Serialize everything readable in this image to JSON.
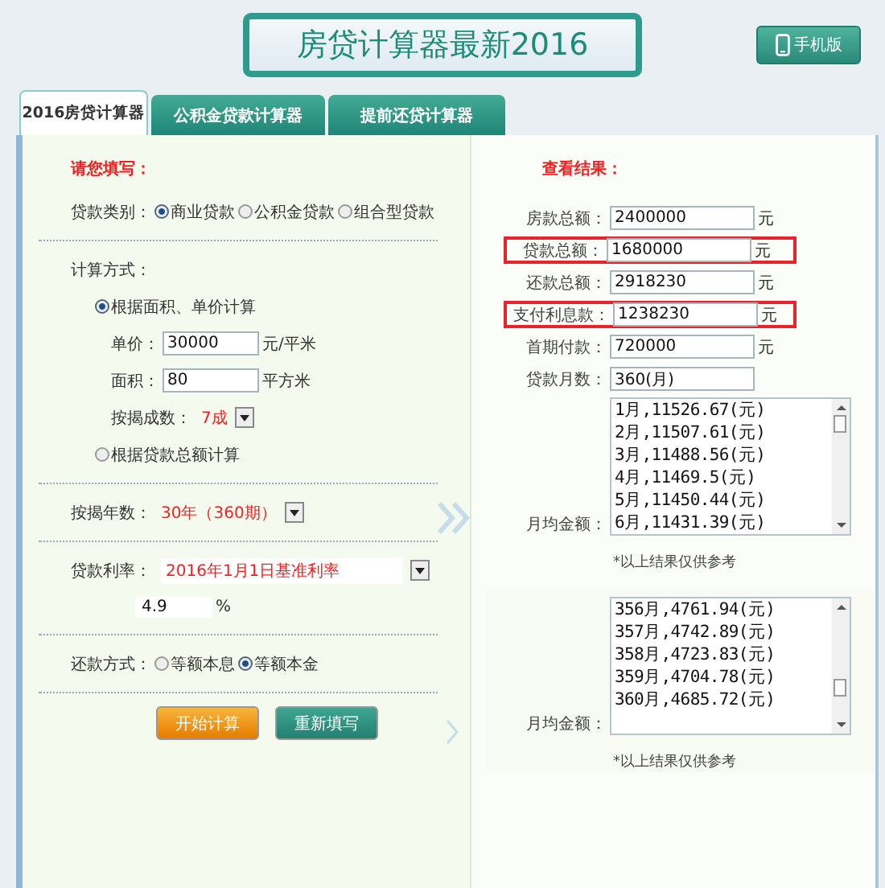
{
  "header": {
    "title": "房贷计算器最新2016",
    "mobile_button": "手机版"
  },
  "tabs": [
    {
      "label": "2016房贷计算器",
      "selected": true
    },
    {
      "label": "公积金贷款计算器",
      "selected": false
    },
    {
      "label": "提前还贷计算器",
      "selected": false
    }
  ],
  "form": {
    "heading": "请您填写：",
    "loan_type": {
      "label": "贷款类别：",
      "options": [
        {
          "label": "商业贷款",
          "selected": true
        },
        {
          "label": "公积金贷款",
          "selected": false
        },
        {
          "label": "组合型贷款",
          "selected": false
        }
      ]
    },
    "calc_label": "计算方式：",
    "calc_options": [
      {
        "label": "根据面积、单价计算",
        "selected": true,
        "fields": [
          {
            "label": "单价：",
            "value": "30000",
            "unit": "元/平米"
          },
          {
            "label": "面积：",
            "value": "80",
            "unit": "平方米"
          }
        ],
        "ratio": {
          "label": "按揭成数：",
          "value": "7成"
        }
      },
      {
        "label": "根据贷款总额计算",
        "selected": false
      }
    ],
    "term": {
      "label": "按揭年数：",
      "value": "30年（360期）"
    },
    "rate": {
      "label": "贷款利率：",
      "value": "2016年1月1日基准利率",
      "input": "4.9",
      "unit": "%"
    },
    "repay": {
      "label": "还款方式：",
      "options": [
        {
          "label": "等额本息",
          "selected": false
        },
        {
          "label": "等额本金",
          "selected": true
        }
      ]
    },
    "buttons": [
      {
        "label": "开始计算",
        "kind": "primary"
      },
      {
        "label": "重新填写",
        "kind": "secondary"
      }
    ]
  },
  "results": {
    "heading": "查看结果：",
    "fields": [
      {
        "label": "房款总额：",
        "value": "2400000",
        "unit": "元",
        "highlighted": false
      },
      {
        "label": "贷款总额：",
        "value": "1680000",
        "unit": "元",
        "highlighted": true
      },
      {
        "label": "还款总额：",
        "value": "2918230",
        "unit": "元",
        "highlighted": false
      },
      {
        "label": "支付利息款：",
        "value": "1238230",
        "unit": "元",
        "highlighted": true
      },
      {
        "label": "首期付款：",
        "value": "720000",
        "unit": "元",
        "highlighted": false
      },
      {
        "label": "贷款月数：",
        "value": "360(月)",
        "highlighted": false
      }
    ],
    "schedules": [
      {
        "label": "月均金额：",
        "lines": [
          "1月,11526.67(元)",
          "2月,11507.61(元)",
          "3月,11488.56(元)",
          "4月,11469.5(元)",
          "5月,11450.44(元)",
          "6月,11431.39(元)"
        ],
        "note": "*以上结果仅供参考"
      },
      {
        "label": "月均金额：",
        "lines": [
          "356月,4761.94(元)",
          "357月,4742.89(元)",
          "358月,4723.83(元)",
          "359月,4704.78(元)",
          "360月,4685.72(元)"
        ],
        "note": "*以上结果仅供参考"
      }
    ]
  }
}
